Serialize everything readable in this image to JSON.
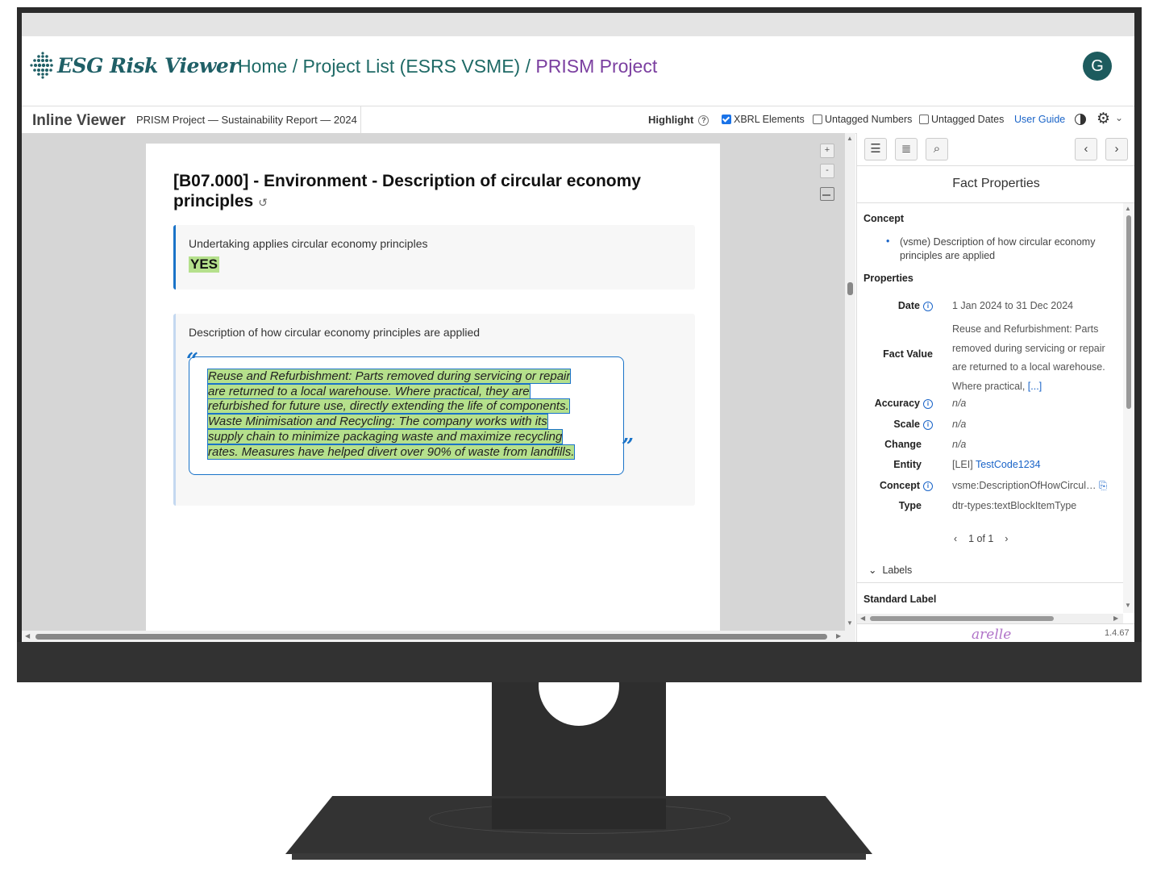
{
  "header": {
    "logo_text": "ESG Risk Viewer",
    "breadcrumb_home": "Home",
    "breadcrumb_sep1": " / ",
    "breadcrumb_list": "Project List (ESRS VSME)",
    "breadcrumb_sep2": " / ",
    "breadcrumb_current": "PRISM Project",
    "avatar_initial": "G"
  },
  "toolbar": {
    "title": "Inline Viewer",
    "document": "PRISM Project — Sustainability Report — 2024",
    "highlight_label": "Highlight",
    "help_icon": "question-circle-icon",
    "options": [
      {
        "label": "XBRL Elements",
        "checked": true
      },
      {
        "label": "Untagged Numbers",
        "checked": false
      },
      {
        "label": "Untagged Dates",
        "checked": false
      }
    ],
    "user_guide": "User Guide"
  },
  "document": {
    "section_title": "[B07.000] - Environment - Description of circular economy principles",
    "card1_label": "Undertaking applies circular economy principles",
    "card1_value": "YES",
    "card2_label": "Description of how circular economy principles are applied",
    "quote_lines": [
      "Reuse and Refurbishment: Parts removed during servicing or repair",
      "are returned to a local warehouse. Where practical, they are",
      "refurbished for future use, directly extending the life of components.",
      "Waste Minimisation and Recycling: The company works with its",
      "supply chain to minimize packaging waste and maximize recycling",
      "rates. Measures have helped divert over 90% of waste from landfills."
    ],
    "zoom_in": "+",
    "zoom_out": "-"
  },
  "panel": {
    "title": "Fact Properties",
    "concept_heading": "Concept",
    "concept_text": "(vsme) Description of how circular economy principles are applied",
    "properties_heading": "Properties",
    "date_label": "Date",
    "date_value": "1 Jan 2024 to 31 Dec 2024",
    "fact_value_label": "Fact Value",
    "fact_value_lines": [
      "Reuse and Refurbishment: Parts",
      "removed during servicing or repair",
      "are returned to a local warehouse.",
      "Where practical,"
    ],
    "fact_value_more": "[...]",
    "accuracy_label": "Accuracy",
    "accuracy_value": "n/a",
    "scale_label": "Scale",
    "scale_value": "n/a",
    "change_label": "Change",
    "change_value": "n/a",
    "entity_label": "Entity",
    "entity_prefix": "[LEI]",
    "entity_value": "TestCode1234",
    "concept_label": "Concept",
    "concept_value": "vsme:DescriptionOfHowCircul…",
    "type_label": "Type",
    "type_value": "dtr-types:textBlockItemType",
    "pager": "1 of 1",
    "labels_toggle": "Labels",
    "standard_label_heading": "Standard Label",
    "footer_brand": "arelle",
    "version": "1.4.67"
  },
  "colors": {
    "brand_teal": "#1f5f66",
    "breadcrumb_current": "#7b3fa0",
    "highlight_green": "#b5e08c",
    "accent_blue": "#1a73c8"
  }
}
